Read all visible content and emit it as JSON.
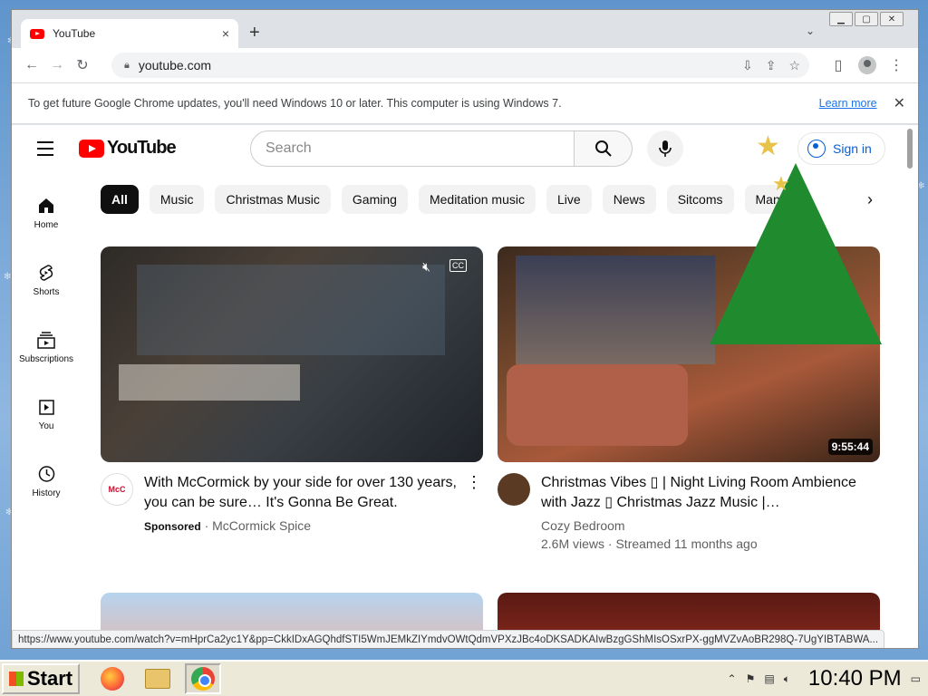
{
  "browser": {
    "tab_title": "YouTube",
    "new_tab": "+",
    "tab_close": "×",
    "tab_search": "⌄",
    "url": "youtube.com",
    "infobar_message": "To get future Google Chrome updates, you'll need Windows 10 or later. This computer is using Windows 7.",
    "infobar_link": "Learn more",
    "infobar_close": "✕",
    "status_url": "https://www.youtube.com/watch?v=mHprCa2yc1Y&pp=CkkIDxAGQhdfSTI5WmJEMkZIYmdvOWtQdmVPXzJBc4oDKSADKAIwBzgGShMIsOSxrPX-ggMVZvAoBR298Q-7UgYIBTABWA..."
  },
  "youtube": {
    "logo_text": "YouTube",
    "search_placeholder": "Search",
    "sign_in": "Sign in",
    "guide": [
      {
        "label": "Home"
      },
      {
        "label": "Shorts"
      },
      {
        "label": "Subscriptions"
      },
      {
        "label": "You"
      },
      {
        "label": "History"
      }
    ],
    "chips": [
      "All",
      "Music",
      "Christmas Music",
      "Gaming",
      "Meditation music",
      "Live",
      "News",
      "Sitcoms",
      "Mann"
    ],
    "videos": [
      {
        "title": "With McCormick by your side for over 130 years, you can be sure… It's Gonna Be Great.",
        "badge": "Sponsored",
        "channel": "McCormick Spice",
        "avatar_text": "McC",
        "cc": "CC"
      },
      {
        "title": "Christmas Vibes ▯ | Night Living Room Ambience with Jazz ▯ Christmas Jazz Music |…",
        "channel": "Cozy Bedroom",
        "stats": "2.6M views · Streamed 11 months ago",
        "duration": "9:55:44"
      }
    ]
  },
  "taskbar": {
    "start_label": "Start",
    "clock": "10:40 PM"
  }
}
